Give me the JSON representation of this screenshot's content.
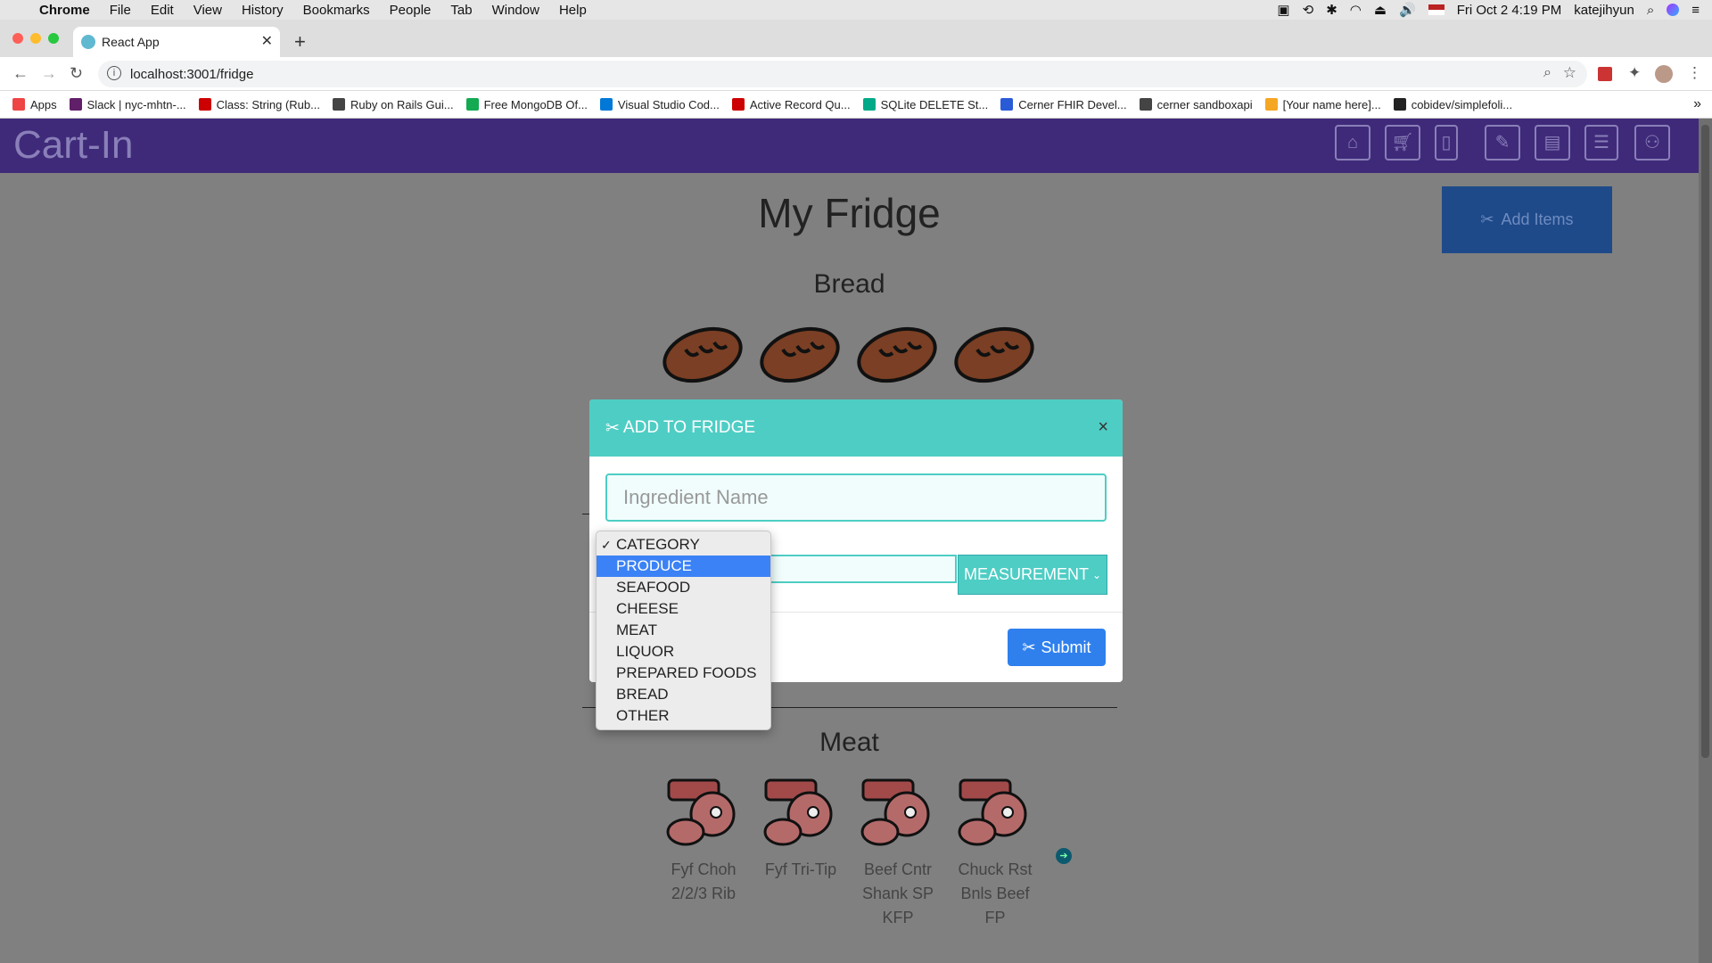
{
  "os_menubar": {
    "apple": "",
    "app": "Chrome",
    "menus": [
      "File",
      "Edit",
      "View",
      "History",
      "Bookmarks",
      "People",
      "Tab",
      "Window",
      "Help"
    ],
    "clock": "Fri Oct 2  4:19 PM",
    "user": "katejihyun"
  },
  "browser": {
    "tab_title": "React App",
    "url": "localhost:3001/fridge",
    "bookmarks": [
      {
        "label": "Apps",
        "color": "#e44"
      },
      {
        "label": "Slack | nyc-mhtn-...",
        "color": "#611f69"
      },
      {
        "label": "Class: String (Rub...",
        "color": "#c00"
      },
      {
        "label": "Ruby on Rails Gui...",
        "color": "#444"
      },
      {
        "label": "Free MongoDB Of...",
        "color": "#13aa52"
      },
      {
        "label": "Visual Studio Cod...",
        "color": "#0078d7"
      },
      {
        "label": "Active Record Qu...",
        "color": "#c00"
      },
      {
        "label": "SQLite DELETE St...",
        "color": "#0a8"
      },
      {
        "label": "Cerner FHIR Devel...",
        "color": "#2a5bd7"
      },
      {
        "label": "cerner sandboxapi",
        "color": "#444"
      },
      {
        "label": "[Your name here]...",
        "color": "#f5a623"
      },
      {
        "label": "cobidev/simplefoli...",
        "color": "#222"
      }
    ]
  },
  "app": {
    "brand": "Cart-In",
    "nav_icons": [
      "home-icon",
      "cart-icon",
      "fridge-icon",
      "recipe-book-icon",
      "recipe-card-icon",
      "calendar-icon",
      "community-icon"
    ],
    "page_title": "My Fridge",
    "add_items_label": "Add Items",
    "sections": {
      "bread": {
        "title": "Bread",
        "count": 4
      },
      "meat": {
        "title": "Meat",
        "items": [
          "Fyf Choh\n2/2/3 Rib",
          "Fyf Tri-Tip",
          "Beef Cntr\nShank SP\nKFP",
          "Chuck Rst\nBnls Beef\nFP"
        ]
      }
    }
  },
  "modal": {
    "title": "ADD TO FRIDGE",
    "close": "×",
    "ingredient_placeholder": "Ingredient Name",
    "measurement_label": "MEASUREMENT",
    "submit_label": "Submit"
  },
  "category_dropdown": {
    "options": [
      "CATEGORY",
      "PRODUCE",
      "SEAFOOD",
      "CHEESE",
      "MEAT",
      "LIQUOR",
      "PREPARED FOODS",
      "BREAD",
      "OTHER"
    ],
    "checked": "CATEGORY",
    "highlighted": "PRODUCE"
  }
}
